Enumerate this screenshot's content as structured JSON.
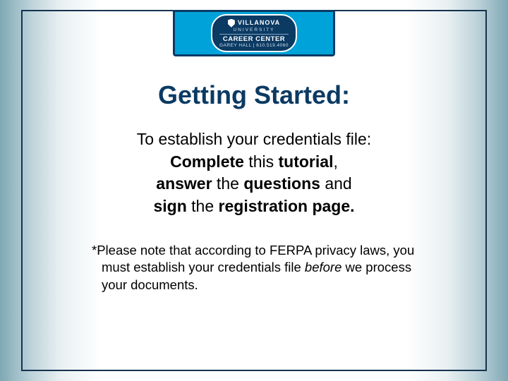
{
  "logo": {
    "univ_line1": "VILLANOVA",
    "univ_line2": "UNIVERSITY",
    "dept": "CAREER CENTER",
    "contact": "GAREY HALL | 610.519.4060"
  },
  "title": "Getting Started:",
  "body": {
    "line1": "To establish your credentials file:",
    "l2a": "Complete",
    "l2b": " this ",
    "l2c": "tutorial",
    "l2d": ",",
    "l3a": "answer",
    "l3b": " the ",
    "l3c": "questions",
    "l3d": " and",
    "l4a": "sign",
    "l4b": " the ",
    "l4c": "registration page."
  },
  "note": {
    "t1": "*Please note that according to FERPA privacy laws, you must establish your credentials file ",
    "t2": "before",
    "t3": " we process your documents."
  }
}
